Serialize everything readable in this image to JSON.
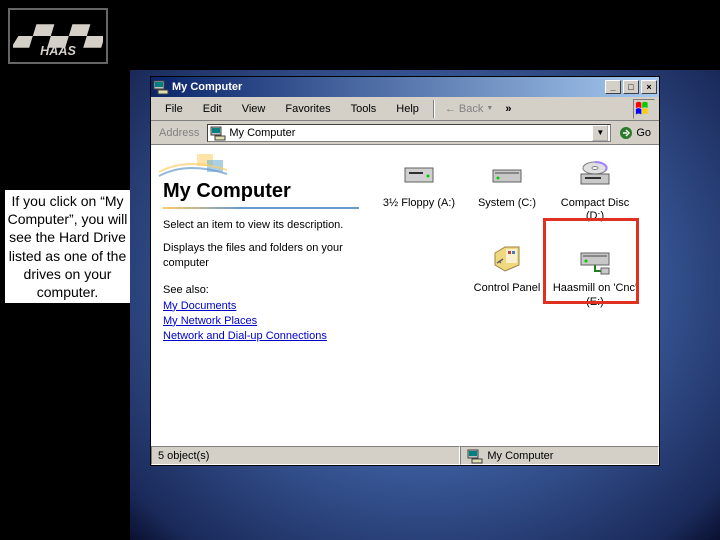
{
  "slide": {
    "caption": "If you click on “My Computer”, you will see the Hard Drive listed as one of the  drives on your computer."
  },
  "window": {
    "title": "My Computer",
    "buttons": {
      "min": "_",
      "max": "□",
      "close": "×"
    },
    "menu": [
      "File",
      "Edit",
      "View",
      "Favorites",
      "Tools",
      "Help"
    ],
    "back_label": "Back",
    "chevron": "»",
    "address_label": "Address",
    "address_value": "My Computer",
    "go_label": "Go"
  },
  "left_pane": {
    "heading": "My Computer",
    "desc": "Select an item to view its description.",
    "sub": "Displays the files and folders on your computer",
    "see_also_label": "See also:",
    "links": [
      "My Documents",
      "My Network Places",
      "Network and Dial-up Connections"
    ]
  },
  "drives": [
    {
      "label": "3½ Floppy (A:)",
      "icon": "floppy"
    },
    {
      "label": "System (C:)",
      "icon": "hdd"
    },
    {
      "label": "Compact Disc (D:)",
      "icon": "cd"
    },
    {
      "label": "Control Panel",
      "icon": "cpanel"
    },
    {
      "label": "Haasmill on 'Cnc' (E:)",
      "icon": "netdrive"
    }
  ],
  "statusbar": {
    "left": "5 object(s)",
    "right": "My Computer"
  }
}
